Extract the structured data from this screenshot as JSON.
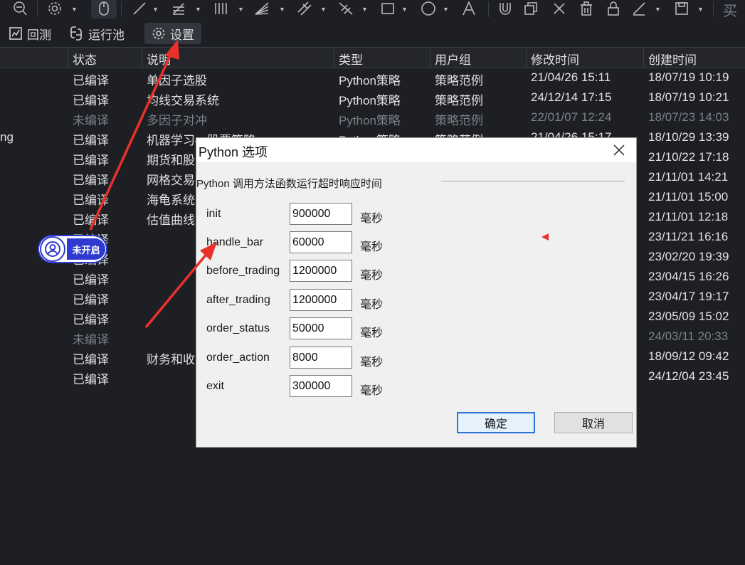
{
  "toolbar": {
    "trailing_char": "买"
  },
  "tabs": [
    {
      "label": "回测",
      "icon": "chart-icon"
    },
    {
      "label": "运行池",
      "icon": "python-icon"
    },
    {
      "label": "设置",
      "icon": "gear-icon",
      "active": true
    }
  ],
  "table": {
    "headers": [
      "状态",
      "说明",
      "类型",
      "用户组",
      "修改时间",
      "创建时间"
    ],
    "rows": [
      {
        "prefix": "",
        "status": "已编译",
        "desc": "单因子选股",
        "type": "Python策略",
        "group": "策略范例",
        "modified": "21/04/26 15:11",
        "created": "18/07/19 10:19",
        "dim": false
      },
      {
        "prefix": "",
        "status": "已编译",
        "desc": "均线交易系统",
        "type": "Python策略",
        "group": "策略范例",
        "modified": "24/12/14 17:15",
        "created": "18/07/19 10:21",
        "dim": false
      },
      {
        "prefix": "",
        "status": "未编译",
        "desc": "多因子对冲",
        "type": "Python策略",
        "group": "策略范例",
        "modified": "22/01/07 12:24",
        "created": "18/07/23 14:03",
        "dim": true
      },
      {
        "prefix": "ng",
        "status": "已编译",
        "desc": "机器学习—股票策略",
        "type": "Python策略",
        "group": "策略范例",
        "modified": "21/04/26 15:17",
        "created": "18/10/29 13:39",
        "dim": false
      },
      {
        "prefix": "",
        "status": "已编译",
        "desc": "期货和股",
        "type": "",
        "group": "",
        "modified": "",
        "created": "21/10/22 17:18",
        "dim": false
      },
      {
        "prefix": "",
        "status": "已编译",
        "desc": "网格交易",
        "type": "",
        "group": "",
        "modified": "",
        "created": "21/11/01 14:21",
        "dim": false
      },
      {
        "prefix": "",
        "status": "已编译",
        "desc": "海龟系统",
        "type": "",
        "group": "",
        "modified": "",
        "created": "21/11/01 15:00",
        "dim": false
      },
      {
        "prefix": "",
        "status": "已编译",
        "desc": "估值曲线",
        "type": "",
        "group": "",
        "modified": "",
        "created": "21/11/01 12:18",
        "dim": false
      },
      {
        "prefix": "",
        "status": "已编译",
        "desc": "",
        "type": "",
        "group": "",
        "modified": "",
        "created": "23/11/21 16:16",
        "dim": false
      },
      {
        "prefix": "",
        "status": "已编译",
        "desc": "",
        "type": "",
        "group": "",
        "modified": "",
        "created": "23/02/20 19:39",
        "dim": false
      },
      {
        "prefix": "",
        "status": "已编译",
        "desc": "",
        "type": "",
        "group": "",
        "modified": "",
        "created": "23/04/15 16:26",
        "dim": false
      },
      {
        "prefix": "",
        "status": "已编译",
        "desc": "",
        "type": "",
        "group": "",
        "modified": "",
        "created": "23/04/17 19:17",
        "dim": false
      },
      {
        "prefix": "",
        "status": "已编译",
        "desc": "",
        "type": "",
        "group": "",
        "modified": "",
        "created": "23/05/09 15:02",
        "dim": false
      },
      {
        "prefix": "",
        "status": "未编译",
        "desc": "",
        "type": "",
        "group": "",
        "modified": "",
        "created": "24/03/11 20:33",
        "dim": true
      },
      {
        "prefix": "",
        "status": "已编译",
        "desc": "财务和收",
        "type": "",
        "group": "",
        "modified": "",
        "created": "18/09/12 09:42",
        "dim": false
      },
      {
        "prefix": "",
        "status": "已编译",
        "desc": "",
        "type": "",
        "group": "",
        "modified": "",
        "created": "24/12/04 23:45",
        "dim": false
      }
    ]
  },
  "badge": {
    "label": "未开启"
  },
  "dialog": {
    "title": "Python 选项",
    "group_label": "Python 调用方法函数运行超时响应时间",
    "params": [
      {
        "label": "init",
        "value": "900000",
        "unit": "毫秒"
      },
      {
        "label": "handle_bar",
        "value": "60000",
        "unit": "毫秒"
      },
      {
        "label": "before_trading",
        "value": "1200000",
        "unit": "毫秒"
      },
      {
        "label": "after_trading",
        "value": "1200000",
        "unit": "毫秒"
      },
      {
        "label": "order_status",
        "value": "50000",
        "unit": "毫秒"
      },
      {
        "label": "order_action",
        "value": "8000",
        "unit": "毫秒"
      },
      {
        "label": "exit",
        "value": "300000",
        "unit": "毫秒"
      }
    ],
    "ok_label": "确定",
    "cancel_label": "取消"
  },
  "colors": {
    "arrow": "#e8312a",
    "badge": "#2f3bd0",
    "primary_border": "#2b73d4"
  }
}
